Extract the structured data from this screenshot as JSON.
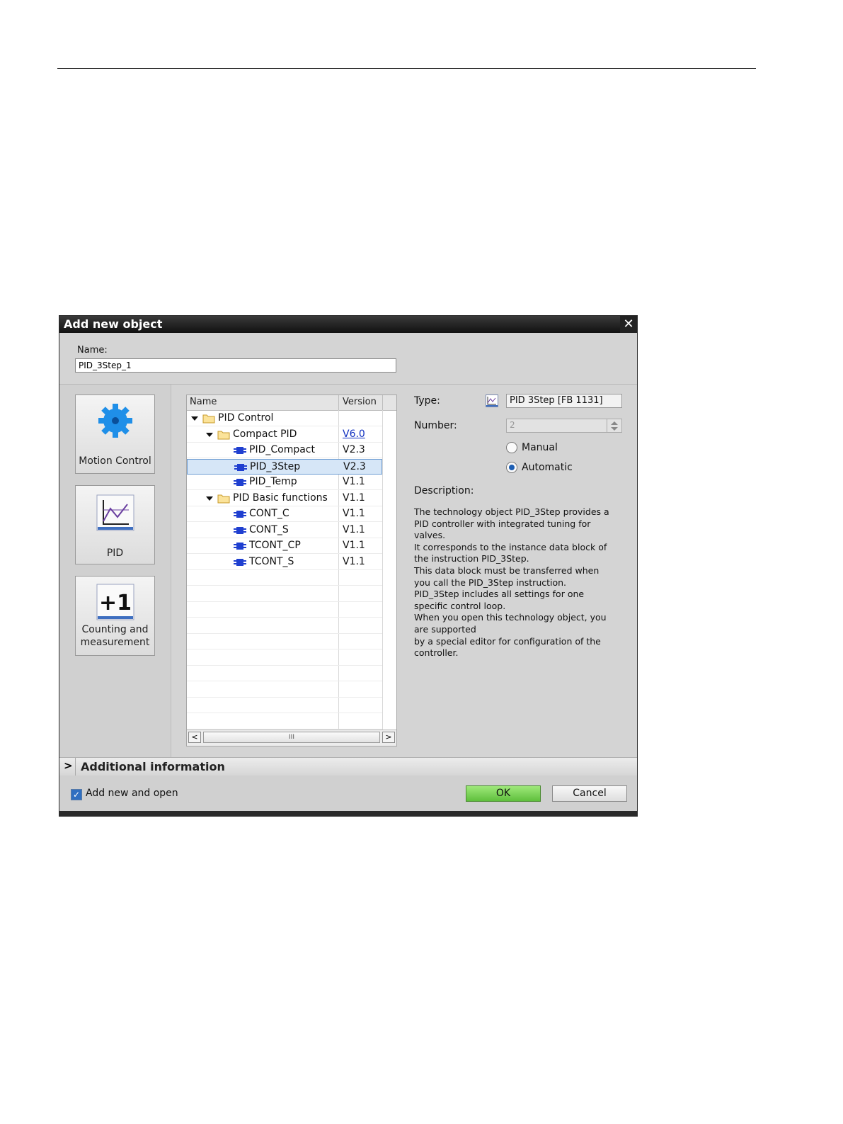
{
  "dialog": {
    "title": "Add new object",
    "name_label": "Name:",
    "name_value": "PID_3Step_1"
  },
  "categories": [
    {
      "label": "Motion Control",
      "icon": "gear-icon"
    },
    {
      "label": "PID",
      "icon": "pid-chart-icon"
    },
    {
      "label": "Counting and measurement",
      "icon": "plus-one-icon"
    }
  ],
  "tree": {
    "headers": {
      "name": "Name",
      "version": "Version"
    },
    "rows": [
      {
        "label": "PID Control",
        "version": "",
        "kind": "folder",
        "level": 0
      },
      {
        "label": "Compact PID",
        "version": "V6.0",
        "kind": "folder",
        "level": 1
      },
      {
        "label": "PID_Compact",
        "version": "V2.3",
        "kind": "block",
        "level": 2
      },
      {
        "label": "PID_3Step",
        "version": "V2.3",
        "kind": "block",
        "level": 2,
        "selected": true
      },
      {
        "label": "PID_Temp",
        "version": "V1.1",
        "kind": "block",
        "level": 2
      },
      {
        "label": "PID Basic functions",
        "version": "V1.1",
        "kind": "folder",
        "level": 1
      },
      {
        "label": "CONT_C",
        "version": "V1.1",
        "kind": "block",
        "level": 2
      },
      {
        "label": "CONT_S",
        "version": "V1.1",
        "kind": "block",
        "level": 2
      },
      {
        "label": "TCONT_CP",
        "version": "V1.1",
        "kind": "block",
        "level": 2
      },
      {
        "label": "TCONT_S",
        "version": "V1.1",
        "kind": "block",
        "level": 2
      }
    ],
    "scroll_thumb_glyph": "III"
  },
  "properties": {
    "type_label": "Type:",
    "type_value": "PID 3Step [FB 1131]",
    "number_label": "Number:",
    "number_value": "2",
    "manual_label": "Manual",
    "automatic_label": "Automatic",
    "description_label": "Description:",
    "description_lines": [
      "The technology object PID_3Step provides a",
      "PID controller with integrated tuning for",
      "valves.",
      "It corresponds to the instance data block of",
      "the instruction PID_3Step.",
      "This data block must be transferred when",
      "you call the PID_3Step instruction.",
      "PID_3Step includes all settings for one",
      "specific control loop.",
      "When you open this technology object, you",
      "are supported",
      "by a special editor for configuration of the",
      "controller."
    ]
  },
  "footer": {
    "additional_info": "Additional  information",
    "add_new_open": "Add new and open",
    "ok": "OK",
    "cancel": "Cancel"
  },
  "colors": {
    "accent": "#2f6fc1",
    "ok_button": "#6fcf4a",
    "selection": "#d6e6f7"
  }
}
